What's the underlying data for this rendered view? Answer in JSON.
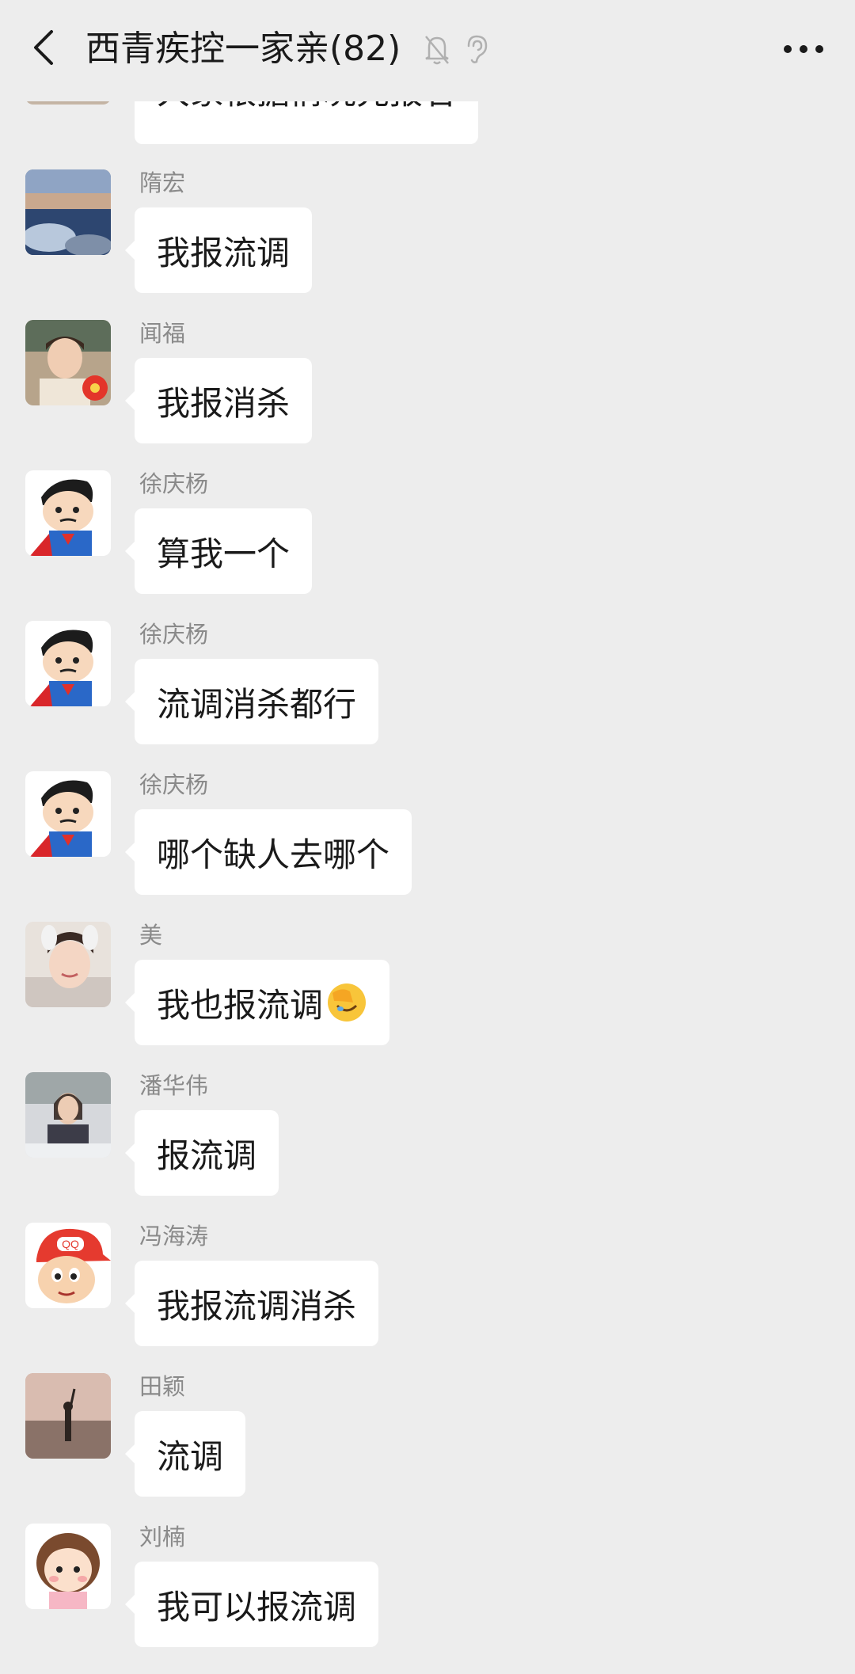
{
  "header": {
    "title": "西青疾控一家亲(82)",
    "icons": [
      "back-icon",
      "bell-muted-icon",
      "ear-icon",
      "more-icon"
    ]
  },
  "partial_message": {
    "text": "大家根据情况先报名"
  },
  "messages": [
    {
      "sender": "隋宏",
      "text": "我报流调",
      "avatar": "lake-avatar"
    },
    {
      "sender": "闻福",
      "text": "我报消杀",
      "avatar": "child-photo-avatar"
    },
    {
      "sender": "徐庆杨",
      "text": "算我一个",
      "avatar": "cartoon-superman-avatar"
    },
    {
      "sender": "徐庆杨",
      "text": "流调消杀都行",
      "avatar": "cartoon-superman-avatar"
    },
    {
      "sender": "徐庆杨",
      "text": "哪个缺人去哪个",
      "avatar": "cartoon-superman-avatar"
    },
    {
      "sender": "美",
      "text": "我也报流调",
      "avatar": "girl-photo-avatar",
      "emoji": "facepalm-emoji"
    },
    {
      "sender": "潘华伟",
      "text": "报流调",
      "avatar": "person-photo-avatar"
    },
    {
      "sender": "冯海涛",
      "text": "我报流调消杀",
      "avatar": "cartoon-qq-cap-avatar"
    },
    {
      "sender": "田颖",
      "text": "流调",
      "avatar": "beach-photo-avatar"
    },
    {
      "sender": "刘楠",
      "text": "我可以报流调",
      "avatar": "cartoon-girl-avatar"
    }
  ]
}
